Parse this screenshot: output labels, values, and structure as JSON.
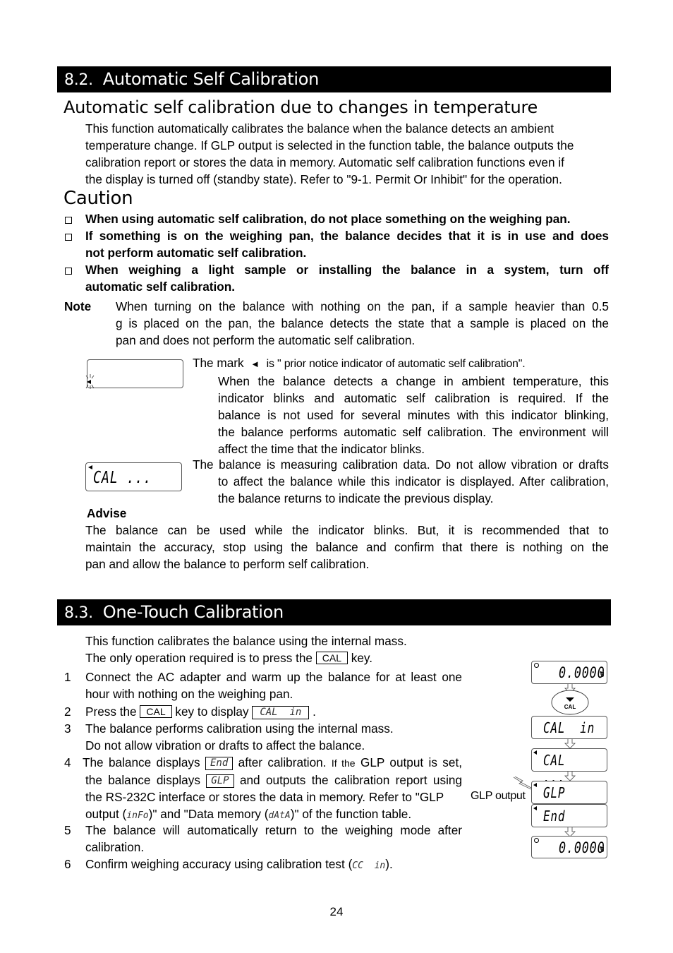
{
  "section_82": {
    "number": "8.2.",
    "title": "Automatic Self Calibration",
    "subheading": "Automatic self calibration due to changes in temperature",
    "intro_lines": [
      "This function automatically calibrates the balance when the balance detects an ambient",
      "temperature change. If GLP output is selected in the function table, the balance outputs the",
      "calibration report or stores the data in memory. Automatic self calibration functions even if",
      "the display is turned off (standby state). Refer to \"9-1. Permit Or Inhibit\" for the operation."
    ],
    "caution_heading": "Caution",
    "caution_items": [
      [
        "When using automatic self calibration, do not place something on the weighing pan."
      ],
      [
        "If something is on the weighing pan, the balance decides that it is in use and does",
        "not perform automatic self calibration."
      ],
      [
        "When weighing a light sample or installing the balance in a system, turn off",
        "automatic self calibration."
      ]
    ],
    "note_label": "Note",
    "note_lines": [
      "When turning on the balance with nothing on the pan, if a sample heavier than 0.5",
      "g is placed on the pan, the balance detects the state that a sample is placed on the",
      "pan and does not perform the automatic self calibration."
    ],
    "indicator_block": {
      "first_line_prefix": "The mark",
      "mark_symbol": "◄",
      "first_line_suffix": "is \" prior notice indicator of automatic self calibration\".",
      "lines": [
        "When the balance detects a change in ambient temperature, this",
        "indicator blinks and automatic self calibration is required. If the",
        "balance is not used for several minutes with this indicator blinking,",
        "the balance performs automatic self calibration. The environment will",
        "affect the time that the indicator blinks."
      ]
    },
    "measuring_block": {
      "display_text": "CAL ...",
      "lines": [
        "The balance is measuring calibration data. Do not allow vibration or drafts",
        "to affect the balance while this indicator is displayed. After calibration,",
        "the balance returns to indicate the previous display."
      ]
    },
    "advise_label": "Advise",
    "advise_lines": [
      "The balance can be used while the indicator blinks. But, it is recommended that to",
      "maintain the accuracy, stop using the balance and confirm that there is nothing on the",
      "pan and allow the balance to perform self calibration."
    ]
  },
  "section_83": {
    "number": "8.3.",
    "title": "One-Touch Calibration",
    "intro_line1": "This function calibrates the balance using the internal mass.",
    "intro_line2_prefix": "The only operation required is to press the",
    "intro_line2_key": "CAL",
    "intro_line2_suffix": "key.",
    "steps": {
      "s1": {
        "num": "1",
        "line1": "Connect the AC adapter and warm up the balance for at least one",
        "line2": "hour with nothing on the weighing pan."
      },
      "s2": {
        "num": "2",
        "prefix": "Press the",
        "key": "CAL",
        "middle": "key to display",
        "display": "CAL  in",
        "suffix": "."
      },
      "s3": {
        "num": "3",
        "line1": "The balance performs calibration using the internal mass.",
        "line2": "Do not allow vibration or drafts to affect the balance."
      },
      "s4": {
        "num": "4",
        "l1_prefix": "The balance displays",
        "l1_display": "End",
        "l1_mid": "after calibration.",
        "l1_small": "If the",
        "l1_suffix": "GLP output is set,",
        "l2_prefix": "the balance displays",
        "l2_display": "GLP",
        "l2_suffix": "and outputs the calibration report using",
        "l3": "the RS-232C interface or stores the data in memory. Refer to \"GLP",
        "l4_prefix": "output (",
        "l4_code1": "inFo",
        "l4_mid": ")\" and \"Data memory (",
        "l4_code2": "dAtA",
        "l4_suffix": ")\" of the function table."
      },
      "s5": {
        "num": "5",
        "line1": "The balance will automatically return to the weighing mode after",
        "line2": "calibration."
      },
      "s6": {
        "num": "6",
        "prefix": "Confirm weighing accuracy using calibration test (",
        "code": "CC  in",
        "suffix": ")."
      }
    },
    "flow": {
      "display1": "0.0000",
      "unit": "g",
      "cal_button": "CAL",
      "display2": "CAL  in",
      "display3": "CAL ...",
      "glp_output_label": "GLP output",
      "display4": "GLP",
      "display5": "End",
      "display6": "0.0000"
    }
  },
  "page_number": "24"
}
